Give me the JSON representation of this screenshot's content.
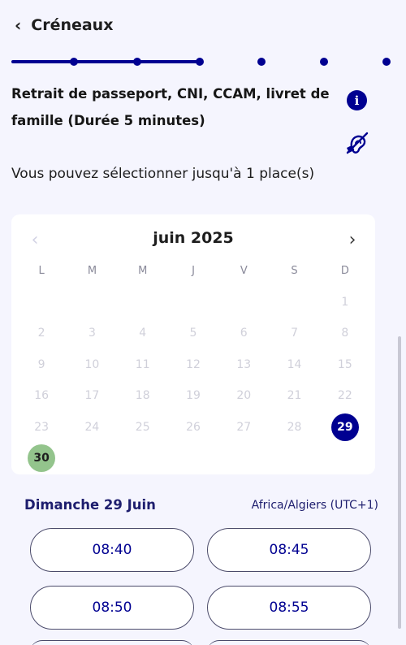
{
  "header": {
    "back_icon": "chevron-left-icon",
    "title": "Créneaux"
  },
  "stepper": {
    "total_steps": 7,
    "completed_steps": 4
  },
  "service": {
    "title": "Retrait de passeport, CNI, CCAM, livret de famille (Durée 5 minutes)",
    "info_icon": "info-icon",
    "accessibility_icon": "hearing-impaired-icon"
  },
  "places_text": "Vous pouvez sélectionner jusqu'à 1 place(s)",
  "calendar": {
    "month_label": "juin 2025",
    "prev_icon": "chevron-left-icon",
    "next_icon": "chevron-right-icon",
    "weekdays": [
      "L",
      "M",
      "M",
      "J",
      "V",
      "S",
      "D"
    ],
    "weeks": [
      [
        "",
        "",
        "",
        "",
        "",
        "",
        "1"
      ],
      [
        "2",
        "3",
        "4",
        "5",
        "6",
        "7",
        "8"
      ],
      [
        "9",
        "10",
        "11",
        "12",
        "13",
        "14",
        "15"
      ],
      [
        "16",
        "17",
        "18",
        "19",
        "20",
        "21",
        "22"
      ],
      [
        "23",
        "24",
        "25",
        "26",
        "27",
        "28",
        "29"
      ],
      [
        "30",
        "",
        "",
        "",
        "",
        "",
        ""
      ]
    ],
    "selected_day": "29",
    "available_days": [
      "30"
    ]
  },
  "slots": {
    "date_label": "Dimanche 29 Juin",
    "timezone": "Africa/Algiers (UTC+1)",
    "times": [
      "08:40",
      "08:45",
      "08:50",
      "08:55"
    ]
  },
  "colors": {
    "primary": "#000091",
    "available": "#93c48c",
    "background": "#f5f5fe"
  }
}
